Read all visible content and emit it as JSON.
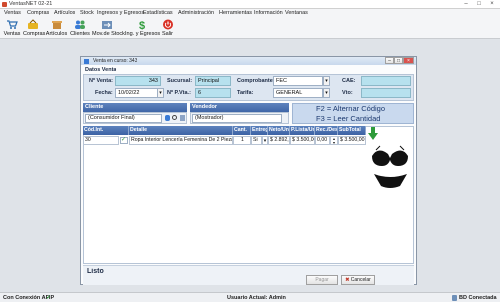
{
  "app": {
    "title": "VentasNET 02-21"
  },
  "menu": [
    "Ventas",
    "Compras",
    "Artículos",
    "Stock",
    "Ingresos y Egresos",
    "Estadísticas",
    "Administración",
    "Herramientas",
    "Información",
    "Ventanas"
  ],
  "toolbar": [
    {
      "label": "Ventas",
      "icon": "cart-icon"
    },
    {
      "label": "Compras",
      "icon": "basket-icon"
    },
    {
      "label": "Artículos",
      "icon": "box-icon"
    },
    {
      "label": "Clientes",
      "icon": "users-icon"
    },
    {
      "label": "Mov.de Stock",
      "icon": "stock-icon"
    },
    {
      "label": "Ing. y Egresos",
      "icon": "dollar-icon"
    },
    {
      "label": "Salir",
      "icon": "power-icon"
    }
  ],
  "window": {
    "title": "Venta en curso: 343",
    "datos_header": "Datos Venta",
    "nro_venta_label": "Nº Venta:",
    "nro_venta": "343",
    "fecha_label": "Fecha:",
    "fecha": "10/02/22",
    "sucursal_label": "Sucursal:",
    "sucursal": "Principal",
    "pvta_label": "Nº P.Vta.:",
    "pvta": "6",
    "comprobante_label": "Comprobante:",
    "comprobante": "FEC",
    "tarifa_label": "Tarifa:",
    "tarifa": "GENERAL",
    "cae_label": "CAE:",
    "vto_label": "Vto:",
    "cliente_header": "Cliente",
    "cliente": "(Consumidor Final)",
    "vendedor_header": "Vendedor",
    "vendedor": "(Mostrador)",
    "hint1": "F2 = Alternar Código",
    "hint2": "F3 = Leer Cantidad",
    "columns": [
      "Cód.Int.",
      "Detalle",
      "Cant.",
      "Entreg",
      "Neto/Un",
      "P.Lista/Un",
      "Rec./Des",
      "SubTotal"
    ],
    "row": {
      "codigo": "30",
      "detalle": "Ropa Interior Lencería Femenina De 2 Pieza",
      "cant": "1",
      "entreg": "Si",
      "neto": "$ 2.892,5",
      "plista": "$ 3.500,00",
      "rec": "0,00",
      "subtotal": "$ 3.500,00"
    },
    "status": "Listo",
    "pagar_label": "Pagar",
    "cancelar_label": "Cancelar"
  },
  "statusbar": {
    "conexion": "Con Conexión AFIP",
    "usuario": "Usuario Actual: Admin",
    "bd": "BD Conectada"
  }
}
